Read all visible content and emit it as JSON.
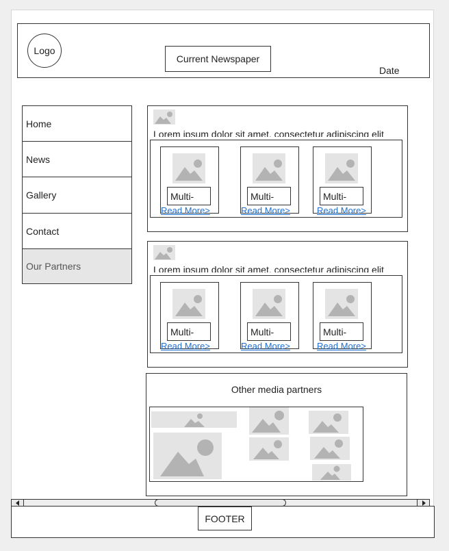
{
  "header": {
    "logo_text": "Logo",
    "title": "Current Newspaper",
    "date_label": "Date"
  },
  "sidebar": {
    "items": [
      {
        "label": "Home"
      },
      {
        "label": "News"
      },
      {
        "label": "Gallery"
      },
      {
        "label": "Contact"
      },
      {
        "label": "Our Partners"
      }
    ],
    "active_index": 4
  },
  "articles": [
    {
      "excerpt": "Lorem ipsum dolor sit amet, consectetur adipiscing elit",
      "cards": [
        {
          "text": "Multi-",
          "link": "Read More>"
        },
        {
          "text": "Multi-",
          "link": "Read More>"
        },
        {
          "text": "Multi-",
          "link": "Read More>"
        }
      ]
    },
    {
      "excerpt": "Lorem ipsum dolor sit amet, consectetur adipiscing elit",
      "cards": [
        {
          "text": "Multi-",
          "link": "Read More>"
        },
        {
          "text": "Multi-",
          "link": "Read More>"
        },
        {
          "text": "Multi-",
          "link": "Read More>"
        }
      ]
    }
  ],
  "partners": {
    "title": "Other media partners"
  },
  "footer": {
    "label": "FOOTER"
  },
  "colors": {
    "link": "#1f6fd0",
    "active_nav_bg": "#e6e6e6",
    "placeholder_bg": "#e4e4e4",
    "placeholder_fg": "#b3b3b3"
  },
  "icons": {
    "image_placeholder": "image-placeholder-icon",
    "scroll_left": "arrow-left-icon",
    "scroll_right": "arrow-right-icon"
  }
}
